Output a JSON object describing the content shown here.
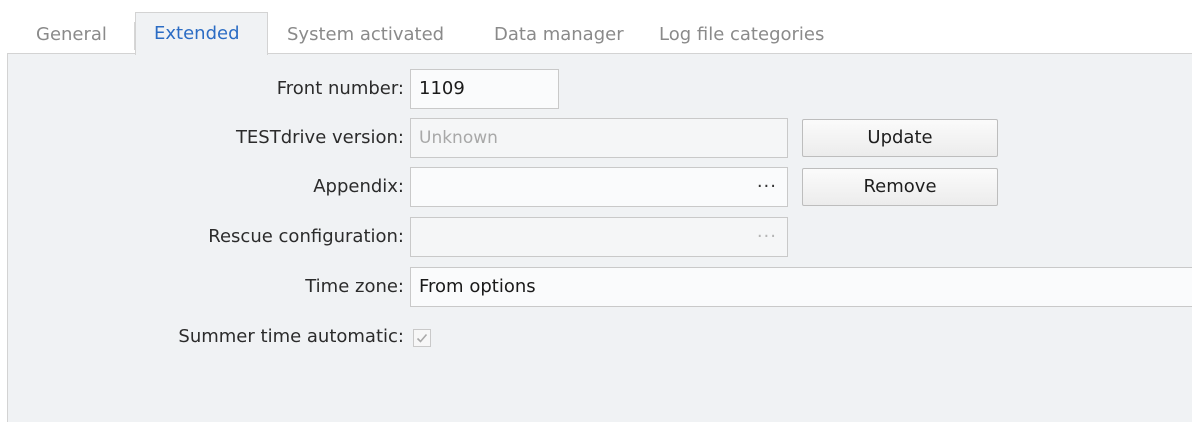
{
  "tabs": [
    {
      "label": "General"
    },
    {
      "label": "Extended"
    },
    {
      "label": "System activated"
    },
    {
      "label": "Data manager"
    },
    {
      "label": "Log file categories"
    }
  ],
  "form": {
    "front_number": {
      "label": "Front number:",
      "value": "1109"
    },
    "testdrive_version": {
      "label": "TESTdrive version:",
      "value": "Unknown"
    },
    "appendix": {
      "label": "Appendix:",
      "value": "",
      "browse": "···"
    },
    "rescue_configuration": {
      "label": "Rescue configuration:",
      "value": "",
      "browse": "···"
    },
    "time_zone": {
      "label": "Time zone:",
      "value": "From options"
    },
    "summer_time_automatic": {
      "label": "Summer time automatic:",
      "checked": true
    }
  },
  "buttons": {
    "update": "Update",
    "remove": "Remove"
  },
  "colors": {
    "accent": "#2b6cc4",
    "panel_bg": "#f0f2f4",
    "inactive_tab": "#8a8a8a"
  }
}
